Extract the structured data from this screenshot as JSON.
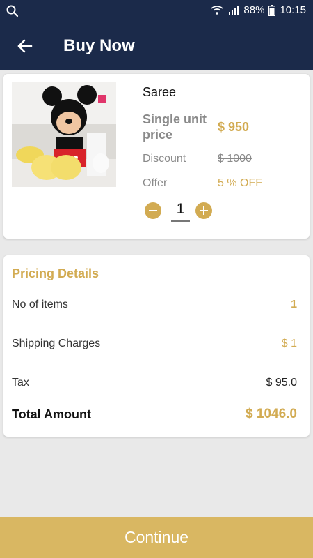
{
  "status_bar": {
    "battery": "88%",
    "time": "10:15"
  },
  "header": {
    "title": "Buy Now"
  },
  "product": {
    "name": "Saree",
    "unit_price_label": "Single unit price",
    "unit_price": "$ 950",
    "discount_label": "Discount",
    "discount_value": "$ 1000",
    "offer_label": "Offer",
    "offer_value": "5 % OFF",
    "quantity": "1"
  },
  "pricing": {
    "title": "Pricing Details",
    "items_label": "No of items",
    "items_value": "1",
    "shipping_label": "Shipping Charges",
    "shipping_value": "$ 1",
    "tax_label": "Tax",
    "tax_value": "$ 95.0",
    "total_label": "Total Amount",
    "total_value": "$ 1046.0"
  },
  "footer": {
    "continue_label": "Continue"
  },
  "icons": [
    "search-icon",
    "wifi-icon",
    "signal-icon",
    "battery-icon",
    "back-arrow-icon",
    "minus-icon",
    "plus-icon"
  ],
  "colors": {
    "header_bg": "#1b2a4a",
    "accent": "#d2ab52",
    "button_bg": "#d9b762"
  }
}
